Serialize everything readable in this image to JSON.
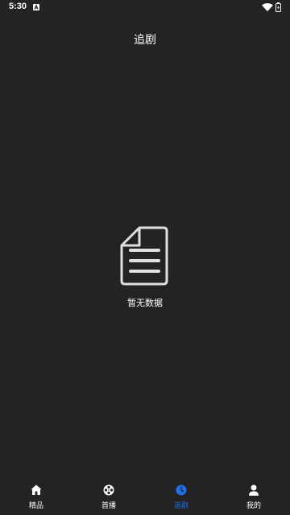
{
  "status_bar": {
    "time": "5:30",
    "icons": [
      "a-notification-icon",
      "wifi-icon",
      "battery-icon"
    ]
  },
  "header": {
    "title": "追剧"
  },
  "empty_state": {
    "icon": "document-icon",
    "message": "暂无数据"
  },
  "bottom_nav": {
    "active_color": "#1e6fe6",
    "items": [
      {
        "label": "精品",
        "icon": "home-icon"
      },
      {
        "label": "首播",
        "icon": "film-reel-icon"
      },
      {
        "label": "追剧",
        "icon": "clock-icon"
      },
      {
        "label": "我的",
        "icon": "user-icon"
      }
    ]
  }
}
